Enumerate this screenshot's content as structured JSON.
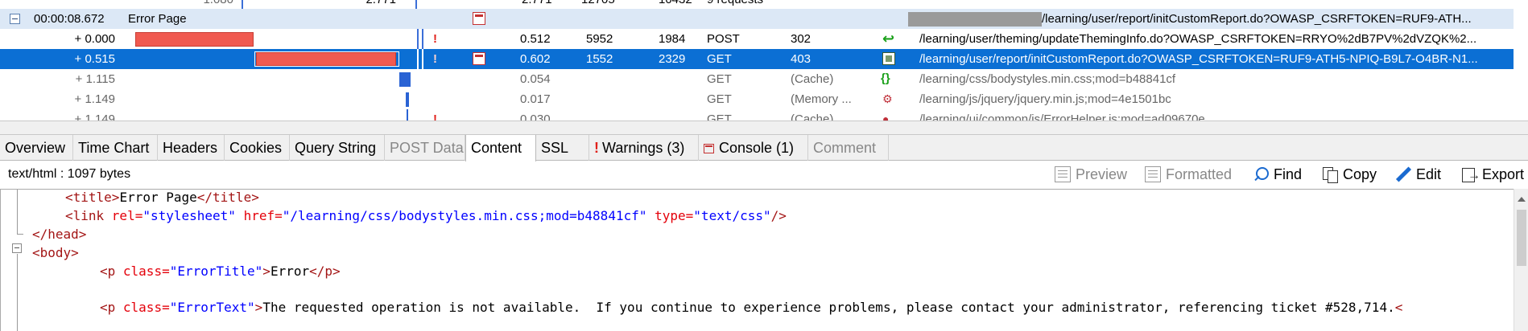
{
  "grid": {
    "partial_top": {
      "offset": "1.080",
      "c1": "2.771",
      "c2": "2.771",
      "c3": "12705",
      "c4": "10432",
      "c5": "9 requests"
    },
    "group": {
      "time": "00:00:08.672",
      "name": "Error Page",
      "url": "/learning/user/report/initCustomReport.do?OWASP_CSRFTOKEN=RUF9-ATH..."
    },
    "rows": [
      {
        "offset": "+ 0.000",
        "warn": "!",
        "duration": "0.512",
        "sent": "5952",
        "received": "1984",
        "method": "POST",
        "result": "302",
        "type_icon": "redirect-icon",
        "url": "/learning/user/theming/updateThemingInfo.do?OWASP_CSRFTOKEN=RRYO%2dB7PV%2dVZQK%2..."
      },
      {
        "offset": "+ 0.515",
        "warn": "!",
        "duration": "0.602",
        "sent": "1552",
        "received": "2329",
        "method": "GET",
        "result": "403",
        "type_icon": "page-icon",
        "url": "/learning/user/report/initCustomReport.do?OWASP_CSRFTOKEN=RUF9-ATH5-NPIQ-B9L7-O4BR-N1..."
      },
      {
        "offset": "+ 1.115",
        "duration": "0.054",
        "method": "GET",
        "result": "(Cache)",
        "type_icon": "css-icon",
        "url": "/learning/css/bodystyles.min.css;mod=b48841cf"
      },
      {
        "offset": "+ 1.149",
        "duration": "0.017",
        "method": "GET",
        "result": "(Memory ...",
        "type_icon": "script-icon",
        "url": "/learning/js/jquery/jquery.min.js;mod=4e1501bc"
      }
    ],
    "partial_bottom": {
      "offset": "+ 1.149",
      "duration": "0.030",
      "method": "GET",
      "result": "(Cache)",
      "url": "/learning/ui/common/js/ErrorHelper.js;mod=ad09670e"
    }
  },
  "tabs": [
    {
      "label": "Overview",
      "state": "normal"
    },
    {
      "label": "Time Chart",
      "state": "normal"
    },
    {
      "label": "Headers",
      "state": "normal"
    },
    {
      "label": "Cookies",
      "state": "normal"
    },
    {
      "label": "Query String",
      "state": "normal"
    },
    {
      "label": "POST Data",
      "state": "disabled"
    },
    {
      "label": "Content",
      "state": "active"
    },
    {
      "label": "SSL",
      "state": "normal"
    },
    {
      "label": "Warnings (3)",
      "state": "normal",
      "icon": "!"
    },
    {
      "label": "Console (1)",
      "state": "normal",
      "icon": "console"
    },
    {
      "label": "Comment",
      "state": "disabled"
    }
  ],
  "toolbar": {
    "info": "text/html : 1097 bytes",
    "preview": "Preview",
    "formatted": "Formatted",
    "find": "Find",
    "copy": "Copy",
    "edit": "Edit",
    "export": "Export"
  },
  "code": {
    "title_open": "<title>",
    "title_text": "Error Page",
    "title_close": "</title>",
    "link_open": "<link ",
    "link_rel_attr": "rel=",
    "link_rel_val": "\"stylesheet\"",
    "link_href_attr": "href=",
    "link_href_val": "\"/learning/css/bodystyles.min.css;mod=b48841cf\"",
    "link_type_attr": "type=",
    "link_type_val": "\"text/css\"",
    "link_close": "/>",
    "head_close": "</head>",
    "body_open": "<body>",
    "p1_open": "<p ",
    "p1_class_attr": "class=",
    "p1_class_val": "\"ErrorTitle\"",
    "p1_gt": ">",
    "p1_text": "Error",
    "p1_close": "</p>",
    "p2_open": "<p ",
    "p2_class_attr": "class=",
    "p2_class_val": "\"ErrorText\"",
    "p2_gt": ">",
    "p2_text": "The requested operation is not available.  If you continue to experience problems, please contact your administrator, referencing ticket #528,714.",
    "p2_tail": "<"
  },
  "colors": {
    "selection": "#0b6fd4",
    "group_row": "#dce8f6",
    "timing_bar": "#f05a50",
    "tag": "#a31515",
    "attr": "#e4000a",
    "value": "#0000ff"
  }
}
